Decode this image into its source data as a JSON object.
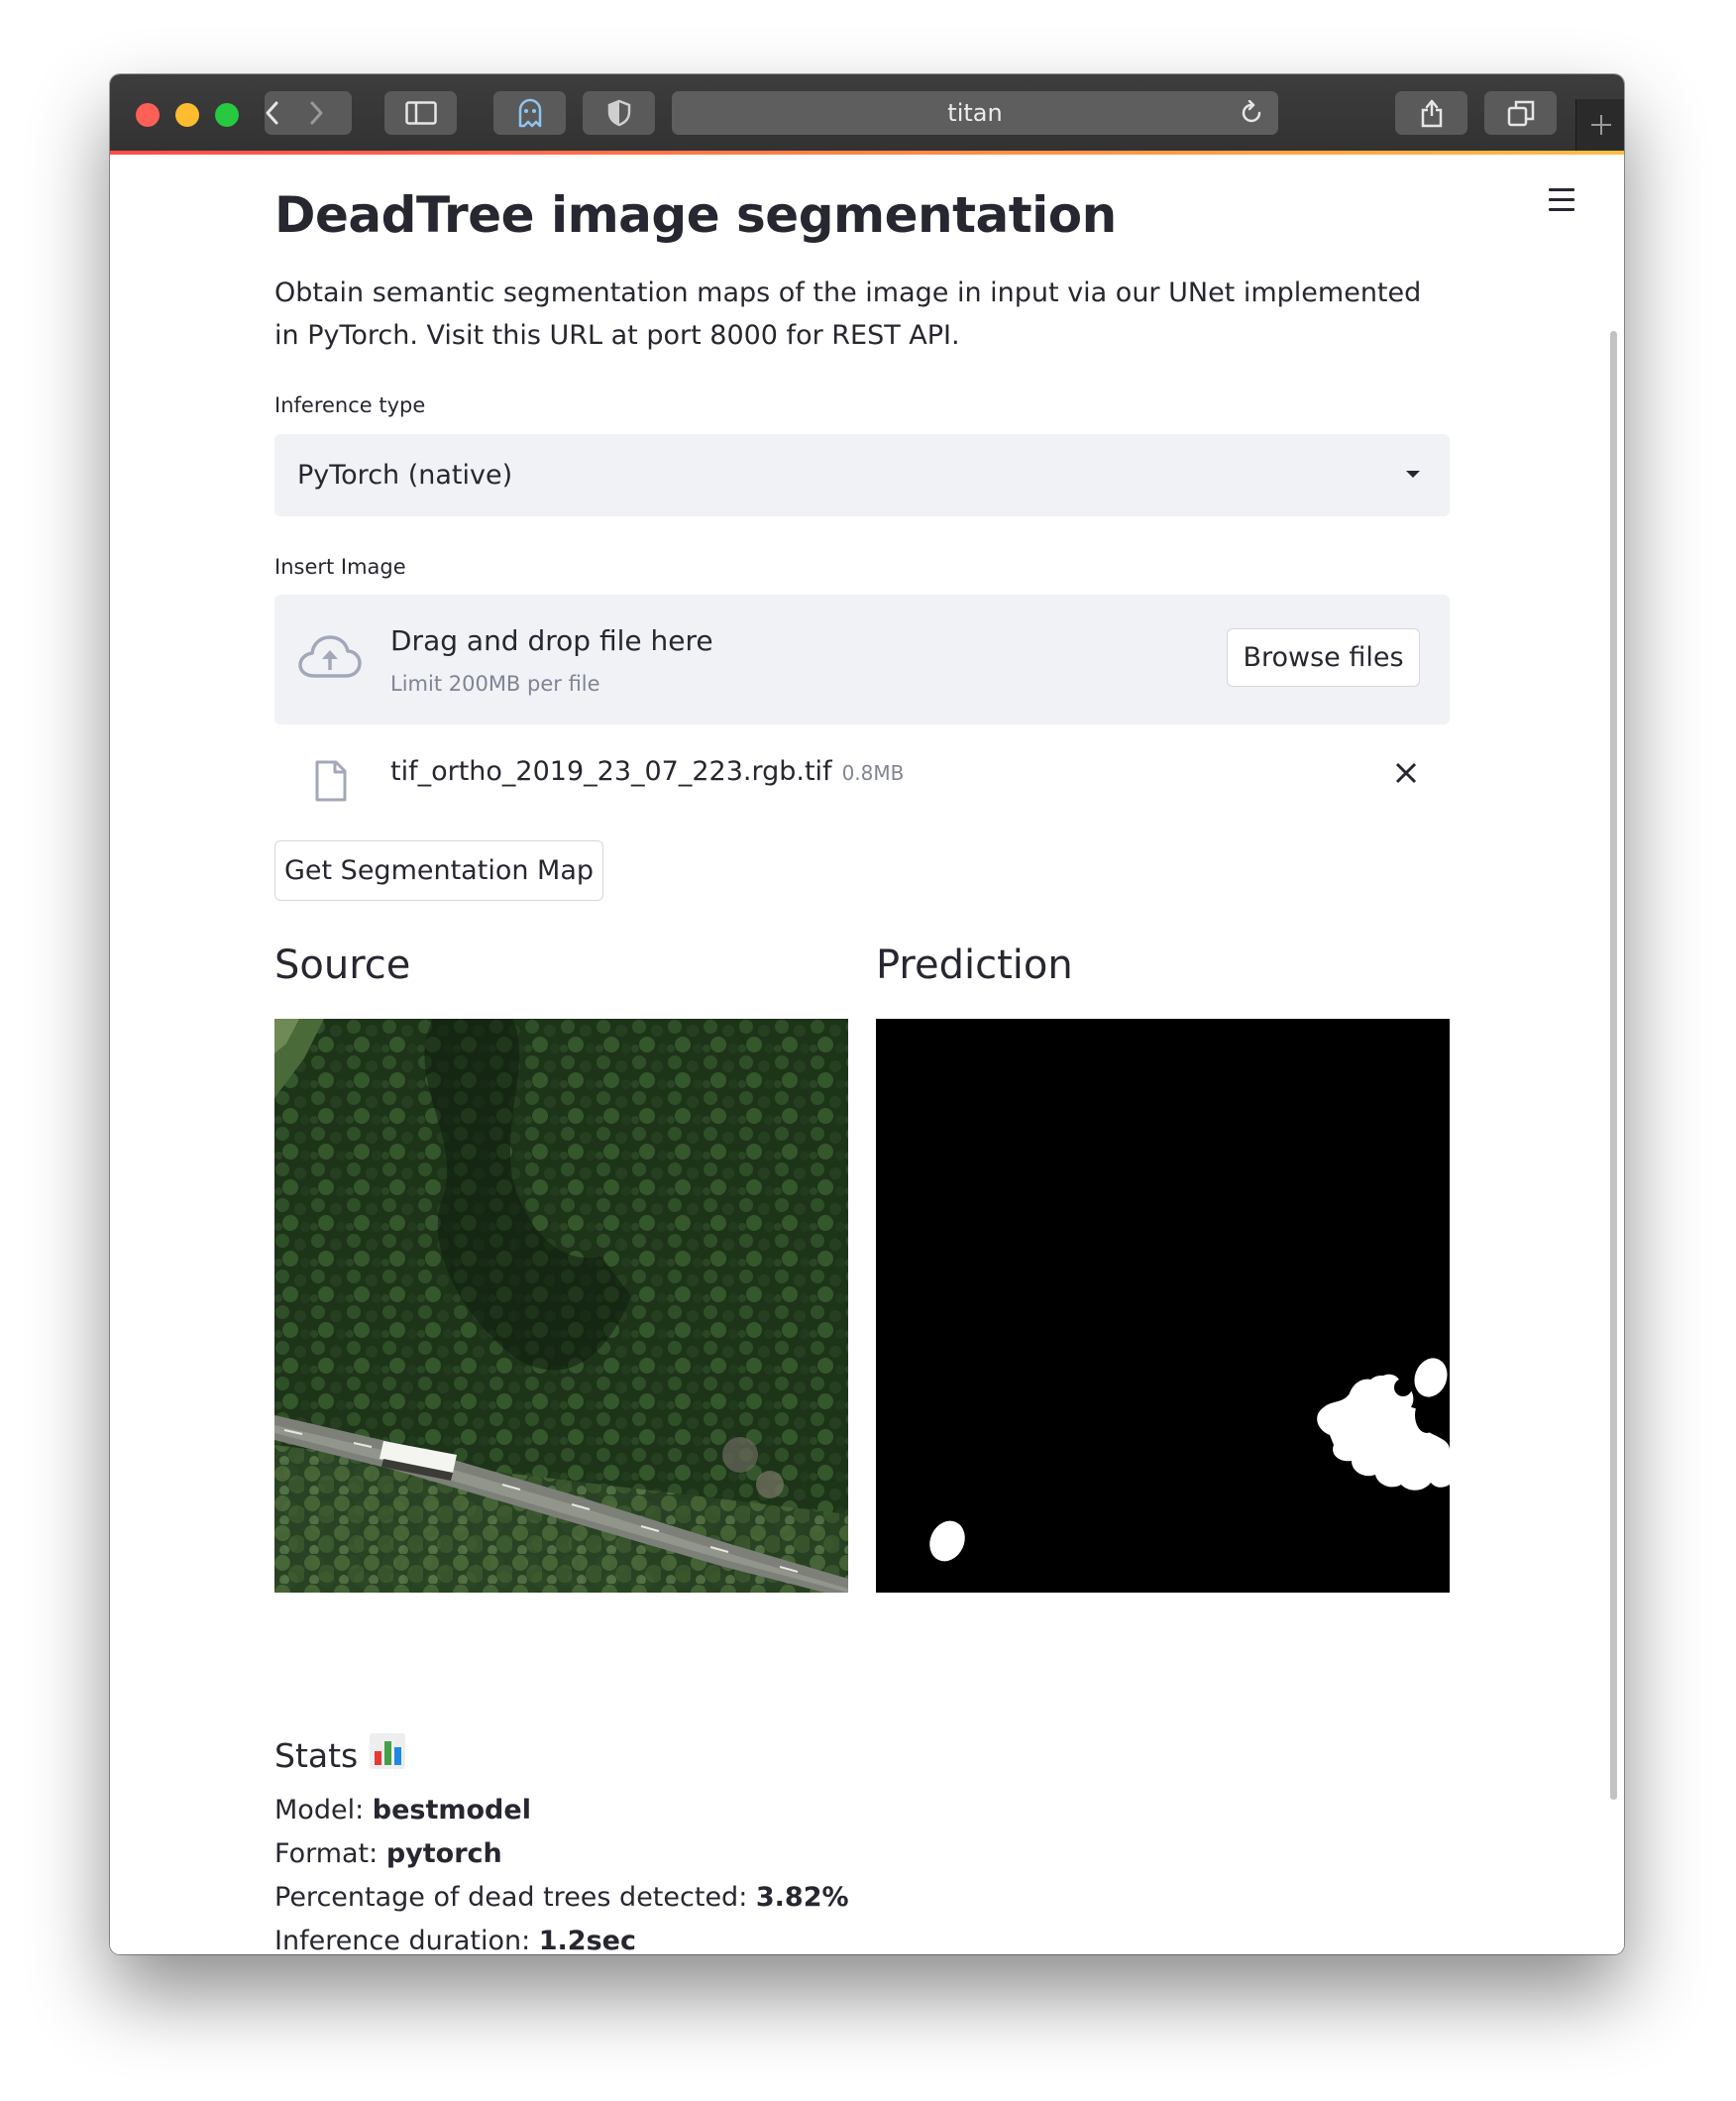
{
  "browser": {
    "url_title": "titan"
  },
  "page": {
    "title": "DeadTree image segmentation",
    "description": "Obtain semantic segmentation maps of the image in input via our UNet implemented in PyTorch. Visit this URL at port 8000 for REST API."
  },
  "inference": {
    "label": "Inference type",
    "selected": "PyTorch (native)"
  },
  "uploader": {
    "label": "Insert Image",
    "drag_text": "Drag and drop file here",
    "limit_text": "Limit 200MB per file",
    "browse_label": "Browse files",
    "file_name": "tif_ortho_2019_23_07_223.rgb.tif",
    "file_size": "0.8MB"
  },
  "actions": {
    "segment_label": "Get Segmentation Map"
  },
  "results": {
    "source_heading": "Source",
    "prediction_heading": "Prediction"
  },
  "stats": {
    "heading": "Stats",
    "model_label": "Model: ",
    "model_value": "bestmodel",
    "format_label": "Format: ",
    "format_value": "pytorch",
    "dead_label": "Percentage of dead trees detected: ",
    "dead_value": "3.82%",
    "duration_label": "Inference duration: ",
    "duration_value": "1.2sec"
  },
  "icons": [
    "chevron-left-icon",
    "chevron-right-icon",
    "sidebar-icon",
    "ghost-icon",
    "shield-icon",
    "reload-icon",
    "share-icon",
    "tabs-icon",
    "plus-icon",
    "menu-icon",
    "cloud-upload-icon",
    "file-icon",
    "close-icon",
    "bar-chart-icon"
  ]
}
